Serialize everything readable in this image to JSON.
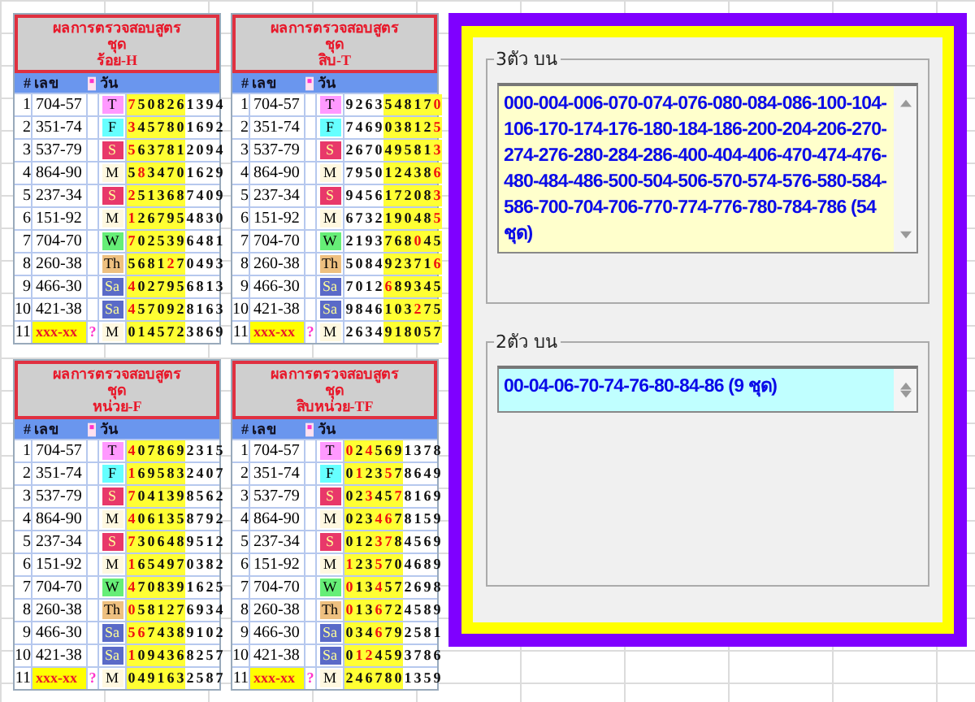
{
  "tables": [
    {
      "title": [
        "ผลการตรวจสอบสูตร",
        "ชุด",
        "ร้อย-H"
      ],
      "headers": [
        "#",
        "เลข",
        "วัน"
      ],
      "highlighted_columns": [
        true,
        true,
        true,
        true,
        true,
        true,
        false,
        false,
        false,
        false
      ],
      "rows": [
        {
          "index": "1",
          "number": "704-57",
          "kind": "entry",
          "day": {
            "label": "T",
            "color": "#ff99ff"
          },
          "digits": [
            "7",
            "5",
            "0",
            "8",
            "2",
            "6",
            "1",
            "3",
            "9",
            "4"
          ],
          "red": [
            true,
            false,
            false,
            false,
            false,
            false,
            false,
            false,
            false,
            false
          ]
        },
        {
          "index": "2",
          "number": "351-74",
          "kind": "entry",
          "day": {
            "label": "F",
            "color": "#66ffff"
          },
          "digits": [
            "3",
            "4",
            "5",
            "7",
            "8",
            "0",
            "1",
            "6",
            "9",
            "2"
          ],
          "red": [
            true,
            false,
            false,
            false,
            false,
            false,
            false,
            false,
            false,
            false
          ]
        },
        {
          "index": "3",
          "number": "537-79",
          "kind": "entry",
          "day": {
            "label": "S",
            "color": "#e8386a"
          },
          "digits": [
            "5",
            "6",
            "3",
            "7",
            "8",
            "1",
            "2",
            "0",
            "9",
            "4"
          ],
          "red": [
            true,
            false,
            false,
            false,
            false,
            false,
            false,
            false,
            false,
            false
          ]
        },
        {
          "index": "4",
          "number": "864-90",
          "kind": "entry",
          "day": {
            "label": "M",
            "color": "#fff8e0"
          },
          "digits": [
            "5",
            "8",
            "3",
            "4",
            "7",
            "0",
            "1",
            "6",
            "2",
            "9"
          ],
          "red": [
            false,
            true,
            false,
            false,
            false,
            false,
            false,
            false,
            false,
            false
          ]
        },
        {
          "index": "5",
          "number": "237-34",
          "kind": "entry",
          "day": {
            "label": "S",
            "color": "#e8386a"
          },
          "digits": [
            "2",
            "5",
            "1",
            "3",
            "6",
            "8",
            "7",
            "4",
            "0",
            "9"
          ],
          "red": [
            true,
            false,
            false,
            false,
            false,
            false,
            false,
            false,
            false,
            false
          ]
        },
        {
          "index": "6",
          "number": "151-92",
          "kind": "entry",
          "day": {
            "label": "M",
            "color": "#fff8e0"
          },
          "digits": [
            "1",
            "2",
            "6",
            "7",
            "9",
            "5",
            "4",
            "8",
            "3",
            "0"
          ],
          "red": [
            true,
            false,
            false,
            false,
            false,
            false,
            false,
            false,
            false,
            false
          ]
        },
        {
          "index": "7",
          "number": "704-70",
          "kind": "entry",
          "day": {
            "label": "W",
            "color": "#66ee77"
          },
          "digits": [
            "7",
            "0",
            "2",
            "5",
            "3",
            "9",
            "6",
            "4",
            "8",
            "1"
          ],
          "red": [
            true,
            false,
            false,
            false,
            false,
            false,
            false,
            false,
            false,
            false
          ]
        },
        {
          "index": "8",
          "number": "260-38",
          "kind": "entry",
          "day": {
            "label": "Th",
            "color": "#eec080"
          },
          "digits": [
            "5",
            "6",
            "8",
            "1",
            "2",
            "7",
            "0",
            "4",
            "9",
            "3"
          ],
          "red": [
            false,
            false,
            false,
            false,
            true,
            false,
            false,
            false,
            false,
            false
          ]
        },
        {
          "index": "9",
          "number": "466-30",
          "kind": "entry",
          "day": {
            "label": "Sa",
            "color": "#5a6ac8"
          },
          "digits": [
            "4",
            "0",
            "2",
            "7",
            "9",
            "5",
            "6",
            "8",
            "1",
            "3"
          ],
          "red": [
            true,
            false,
            false,
            false,
            false,
            false,
            false,
            false,
            false,
            false
          ]
        },
        {
          "index": "10",
          "number": "421-38",
          "kind": "entry",
          "day": {
            "label": "Sa",
            "color": "#5a6ac8"
          },
          "digits": [
            "4",
            "5",
            "7",
            "0",
            "9",
            "2",
            "8",
            "1",
            "6",
            "3"
          ],
          "red": [
            true,
            false,
            false,
            false,
            false,
            false,
            false,
            false,
            false,
            false
          ]
        },
        {
          "index": "11",
          "number": "xxx-xx",
          "kind": "pending",
          "mark": "?",
          "day": {
            "label": "M",
            "color": "#fff8e0"
          },
          "digits": [
            "0",
            "1",
            "4",
            "5",
            "7",
            "2",
            "3",
            "8",
            "6",
            "9"
          ],
          "red": [
            false,
            false,
            false,
            false,
            false,
            false,
            false,
            false,
            false,
            false
          ]
        }
      ]
    },
    {
      "title": [
        "ผลการตรวจสอบสูตร",
        "ชุด",
        "สิบ-T"
      ],
      "headers": [
        "#",
        "เลข",
        "วัน"
      ],
      "highlighted_columns": [
        false,
        false,
        false,
        false,
        true,
        true,
        true,
        true,
        true,
        true
      ],
      "rows": [
        {
          "index": "1",
          "number": "704-57",
          "kind": "entry",
          "day": {
            "label": "T",
            "color": "#ff99ff"
          },
          "digits": [
            "9",
            "2",
            "6",
            "3",
            "5",
            "4",
            "8",
            "1",
            "7",
            "0"
          ],
          "red": [
            false,
            false,
            false,
            false,
            false,
            false,
            false,
            false,
            false,
            true
          ]
        },
        {
          "index": "2",
          "number": "351-74",
          "kind": "entry",
          "day": {
            "label": "F",
            "color": "#66ffff"
          },
          "digits": [
            "7",
            "4",
            "6",
            "9",
            "0",
            "3",
            "8",
            "1",
            "2",
            "5"
          ],
          "red": [
            false,
            false,
            false,
            false,
            false,
            false,
            false,
            false,
            false,
            true
          ]
        },
        {
          "index": "3",
          "number": "537-79",
          "kind": "entry",
          "day": {
            "label": "S",
            "color": "#e8386a"
          },
          "digits": [
            "2",
            "6",
            "7",
            "0",
            "4",
            "9",
            "5",
            "8",
            "1",
            "3"
          ],
          "red": [
            false,
            false,
            false,
            false,
            false,
            false,
            false,
            false,
            false,
            true
          ]
        },
        {
          "index": "4",
          "number": "864-90",
          "kind": "entry",
          "day": {
            "label": "M",
            "color": "#fff8e0"
          },
          "digits": [
            "7",
            "9",
            "5",
            "0",
            "1",
            "2",
            "4",
            "3",
            "8",
            "6"
          ],
          "red": [
            false,
            false,
            false,
            false,
            false,
            false,
            false,
            false,
            false,
            true
          ]
        },
        {
          "index": "5",
          "number": "237-34",
          "kind": "entry",
          "day": {
            "label": "S",
            "color": "#e8386a"
          },
          "digits": [
            "9",
            "4",
            "5",
            "6",
            "1",
            "7",
            "2",
            "0",
            "8",
            "3"
          ],
          "red": [
            false,
            false,
            false,
            false,
            false,
            false,
            false,
            false,
            false,
            true
          ]
        },
        {
          "index": "6",
          "number": "151-92",
          "kind": "entry",
          "day": {
            "label": "M",
            "color": "#fff8e0"
          },
          "digits": [
            "6",
            "7",
            "3",
            "2",
            "1",
            "9",
            "0",
            "4",
            "8",
            "5"
          ],
          "red": [
            false,
            false,
            false,
            false,
            false,
            false,
            false,
            false,
            false,
            true
          ]
        },
        {
          "index": "7",
          "number": "704-70",
          "kind": "entry",
          "day": {
            "label": "W",
            "color": "#66ee77"
          },
          "digits": [
            "2",
            "1",
            "9",
            "3",
            "7",
            "6",
            "8",
            "0",
            "4",
            "5"
          ],
          "red": [
            false,
            false,
            false,
            false,
            false,
            false,
            false,
            true,
            false,
            false
          ]
        },
        {
          "index": "8",
          "number": "260-38",
          "kind": "entry",
          "day": {
            "label": "Th",
            "color": "#eec080"
          },
          "digits": [
            "5",
            "0",
            "8",
            "4",
            "9",
            "2",
            "3",
            "7",
            "1",
            "6"
          ],
          "red": [
            false,
            false,
            false,
            false,
            false,
            false,
            false,
            false,
            false,
            true
          ]
        },
        {
          "index": "9",
          "number": "466-30",
          "kind": "entry",
          "day": {
            "label": "Sa",
            "color": "#5a6ac8"
          },
          "digits": [
            "7",
            "0",
            "1",
            "2",
            "6",
            "8",
            "9",
            "3",
            "4",
            "5"
          ],
          "red": [
            false,
            false,
            false,
            false,
            true,
            false,
            false,
            false,
            false,
            false
          ]
        },
        {
          "index": "10",
          "number": "421-38",
          "kind": "entry",
          "day": {
            "label": "Sa",
            "color": "#5a6ac8"
          },
          "digits": [
            "9",
            "8",
            "4",
            "6",
            "1",
            "0",
            "3",
            "2",
            "7",
            "5"
          ],
          "red": [
            false,
            false,
            false,
            false,
            false,
            false,
            false,
            true,
            false,
            false
          ]
        },
        {
          "index": "11",
          "number": "xxx-xx",
          "kind": "pending",
          "mark": "?",
          "day": {
            "label": "M",
            "color": "#fff8e0"
          },
          "digits": [
            "2",
            "6",
            "3",
            "4",
            "9",
            "1",
            "8",
            "0",
            "5",
            "7"
          ],
          "red": [
            false,
            false,
            false,
            false,
            false,
            false,
            false,
            false,
            false,
            false
          ]
        }
      ]
    },
    {
      "title": [
        "ผลการตรวจสอบสูตร",
        "ชุด",
        "หน่วย-F"
      ],
      "headers": [
        "#",
        "เลข",
        "วัน"
      ],
      "highlighted_columns": [
        true,
        true,
        true,
        true,
        true,
        true,
        false,
        false,
        false,
        false
      ],
      "rows": [
        {
          "index": "1",
          "number": "704-57",
          "kind": "entry",
          "day": {
            "label": "T",
            "color": "#ff99ff"
          },
          "digits": [
            "4",
            "0",
            "7",
            "8",
            "6",
            "9",
            "2",
            "3",
            "1",
            "5"
          ],
          "red": [
            true,
            false,
            false,
            false,
            false,
            false,
            false,
            false,
            false,
            false
          ]
        },
        {
          "index": "2",
          "number": "351-74",
          "kind": "entry",
          "day": {
            "label": "F",
            "color": "#66ffff"
          },
          "digits": [
            "1",
            "6",
            "9",
            "5",
            "8",
            "3",
            "2",
            "4",
            "0",
            "7"
          ],
          "red": [
            true,
            false,
            false,
            false,
            false,
            false,
            false,
            false,
            false,
            false
          ]
        },
        {
          "index": "3",
          "number": "537-79",
          "kind": "entry",
          "day": {
            "label": "S",
            "color": "#e8386a"
          },
          "digits": [
            "7",
            "0",
            "4",
            "1",
            "3",
            "9",
            "8",
            "5",
            "6",
            "2"
          ],
          "red": [
            true,
            false,
            false,
            false,
            false,
            false,
            false,
            false,
            false,
            false
          ]
        },
        {
          "index": "4",
          "number": "864-90",
          "kind": "entry",
          "day": {
            "label": "M",
            "color": "#fff8e0"
          },
          "digits": [
            "4",
            "0",
            "6",
            "1",
            "3",
            "5",
            "8",
            "7",
            "9",
            "2"
          ],
          "red": [
            true,
            false,
            false,
            false,
            false,
            false,
            false,
            false,
            false,
            false
          ]
        },
        {
          "index": "5",
          "number": "237-34",
          "kind": "entry",
          "day": {
            "label": "S",
            "color": "#e8386a"
          },
          "digits": [
            "7",
            "3",
            "0",
            "6",
            "4",
            "8",
            "9",
            "5",
            "1",
            "2"
          ],
          "red": [
            true,
            false,
            false,
            false,
            false,
            false,
            false,
            false,
            false,
            false
          ]
        },
        {
          "index": "6",
          "number": "151-92",
          "kind": "entry",
          "day": {
            "label": "M",
            "color": "#fff8e0"
          },
          "digits": [
            "1",
            "6",
            "5",
            "4",
            "9",
            "7",
            "0",
            "3",
            "8",
            "2"
          ],
          "red": [
            true,
            false,
            false,
            false,
            false,
            false,
            false,
            false,
            false,
            false
          ]
        },
        {
          "index": "7",
          "number": "704-70",
          "kind": "entry",
          "day": {
            "label": "W",
            "color": "#66ee77"
          },
          "digits": [
            "4",
            "7",
            "0",
            "8",
            "3",
            "9",
            "1",
            "6",
            "2",
            "5"
          ],
          "red": [
            true,
            false,
            false,
            false,
            false,
            false,
            false,
            false,
            false,
            false
          ]
        },
        {
          "index": "8",
          "number": "260-38",
          "kind": "entry",
          "day": {
            "label": "Th",
            "color": "#eec080"
          },
          "digits": [
            "0",
            "5",
            "8",
            "1",
            "2",
            "7",
            "6",
            "9",
            "3",
            "4"
          ],
          "red": [
            true,
            false,
            false,
            false,
            false,
            false,
            false,
            false,
            false,
            false
          ]
        },
        {
          "index": "9",
          "number": "466-30",
          "kind": "entry",
          "day": {
            "label": "Sa",
            "color": "#5a6ac8"
          },
          "digits": [
            "5",
            "6",
            "7",
            "4",
            "3",
            "8",
            "9",
            "1",
            "0",
            "2"
          ],
          "red": [
            true,
            true,
            false,
            false,
            false,
            false,
            false,
            false,
            false,
            false
          ]
        },
        {
          "index": "10",
          "number": "421-38",
          "kind": "entry",
          "day": {
            "label": "Sa",
            "color": "#5a6ac8"
          },
          "digits": [
            "1",
            "0",
            "9",
            "4",
            "3",
            "6",
            "8",
            "2",
            "5",
            "7"
          ],
          "red": [
            true,
            false,
            false,
            false,
            false,
            false,
            false,
            false,
            false,
            false
          ]
        },
        {
          "index": "11",
          "number": "xxx-xx",
          "kind": "pending",
          "mark": "?",
          "day": {
            "label": "M",
            "color": "#fff8e0"
          },
          "digits": [
            "0",
            "4",
            "9",
            "1",
            "6",
            "3",
            "2",
            "5",
            "8",
            "7"
          ],
          "red": [
            false,
            false,
            false,
            false,
            false,
            false,
            false,
            false,
            false,
            false
          ]
        }
      ]
    },
    {
      "title": [
        "ผลการตรวจสอบสูตร",
        "ชุด",
        "สิบหน่วย-TF"
      ],
      "headers": [
        "#",
        "เลข",
        "วัน"
      ],
      "highlighted_columns": [
        true,
        true,
        true,
        true,
        true,
        true,
        false,
        false,
        false,
        false
      ],
      "rows": [
        {
          "index": "1",
          "number": "704-57",
          "kind": "entry",
          "day": {
            "label": "T",
            "color": "#ff99ff"
          },
          "digits": [
            "0",
            "2",
            "4",
            "5",
            "6",
            "9",
            "1",
            "3",
            "7",
            "8"
          ],
          "red": [
            true,
            false,
            true,
            false,
            false,
            false,
            false,
            false,
            false,
            false
          ]
        },
        {
          "index": "2",
          "number": "351-74",
          "kind": "entry",
          "day": {
            "label": "F",
            "color": "#66ffff"
          },
          "digits": [
            "0",
            "1",
            "2",
            "3",
            "5",
            "7",
            "8",
            "6",
            "4",
            "9"
          ],
          "red": [
            false,
            true,
            false,
            false,
            true,
            false,
            false,
            false,
            false,
            false
          ]
        },
        {
          "index": "3",
          "number": "537-79",
          "kind": "entry",
          "day": {
            "label": "S",
            "color": "#e8386a"
          },
          "digits": [
            "0",
            "2",
            "3",
            "4",
            "5",
            "7",
            "8",
            "1",
            "6",
            "9"
          ],
          "red": [
            false,
            false,
            true,
            false,
            false,
            true,
            false,
            false,
            false,
            false
          ]
        },
        {
          "index": "4",
          "number": "864-90",
          "kind": "entry",
          "day": {
            "label": "M",
            "color": "#fff8e0"
          },
          "digits": [
            "0",
            "2",
            "3",
            "4",
            "6",
            "7",
            "8",
            "1",
            "5",
            "9"
          ],
          "red": [
            false,
            false,
            false,
            true,
            true,
            false,
            false,
            false,
            false,
            false
          ]
        },
        {
          "index": "5",
          "number": "237-34",
          "kind": "entry",
          "day": {
            "label": "S",
            "color": "#e8386a"
          },
          "digits": [
            "0",
            "1",
            "2",
            "3",
            "7",
            "8",
            "4",
            "5",
            "6",
            "9"
          ],
          "red": [
            false,
            false,
            false,
            true,
            true,
            false,
            false,
            false,
            false,
            false
          ]
        },
        {
          "index": "6",
          "number": "151-92",
          "kind": "entry",
          "day": {
            "label": "M",
            "color": "#fff8e0"
          },
          "digits": [
            "1",
            "2",
            "3",
            "5",
            "7",
            "0",
            "4",
            "6",
            "8",
            "9"
          ],
          "red": [
            true,
            false,
            false,
            true,
            false,
            false,
            false,
            false,
            false,
            false
          ]
        },
        {
          "index": "7",
          "number": "704-70",
          "kind": "entry",
          "day": {
            "label": "W",
            "color": "#66ee77"
          },
          "digits": [
            "0",
            "1",
            "3",
            "4",
            "5",
            "7",
            "2",
            "6",
            "9",
            "8"
          ],
          "red": [
            true,
            false,
            false,
            true,
            false,
            false,
            false,
            false,
            false,
            false
          ]
        },
        {
          "index": "8",
          "number": "260-38",
          "kind": "entry",
          "day": {
            "label": "Th",
            "color": "#eec080"
          },
          "digits": [
            "0",
            "1",
            "3",
            "6",
            "7",
            "2",
            "4",
            "5",
            "8",
            "9"
          ],
          "red": [
            true,
            false,
            false,
            true,
            false,
            false,
            false,
            false,
            false,
            false
          ]
        },
        {
          "index": "9",
          "number": "466-30",
          "kind": "entry",
          "day": {
            "label": "Sa",
            "color": "#5a6ac8"
          },
          "digits": [
            "0",
            "3",
            "4",
            "6",
            "7",
            "9",
            "2",
            "5",
            "8",
            "1"
          ],
          "red": [
            false,
            false,
            false,
            true,
            false,
            false,
            false,
            false,
            false,
            false
          ]
        },
        {
          "index": "10",
          "number": "421-38",
          "kind": "entry",
          "day": {
            "label": "Sa",
            "color": "#5a6ac8"
          },
          "digits": [
            "0",
            "1",
            "2",
            "4",
            "5",
            "9",
            "3",
            "7",
            "8",
            "6"
          ],
          "red": [
            false,
            true,
            true,
            false,
            false,
            false,
            false,
            false,
            false,
            false
          ]
        },
        {
          "index": "11",
          "number": "xxx-xx",
          "kind": "pending",
          "mark": "?",
          "day": {
            "label": "M",
            "color": "#fff8e0"
          },
          "digits": [
            "2",
            "4",
            "6",
            "7",
            "8",
            "0",
            "1",
            "3",
            "5",
            "9"
          ],
          "red": [
            false,
            false,
            false,
            false,
            false,
            false,
            false,
            false,
            false,
            false
          ]
        }
      ]
    }
  ],
  "results": [
    {
      "label": "3ตัว บน",
      "text": "000-004-006-070-074-076-080-084-086-100-104-106-170-174-176-180-184-186-200-204-206-270-274-276-280-284-286-400-404-406-470-474-476-480-484-486-500-504-506-570-574-576-580-584-586-700-704-706-770-774-776-780-784-786  (54 ชุด)",
      "color": "#ffffcc"
    },
    {
      "label": "2ตัว บน",
      "text": "00-04-06-70-74-76-80-84-86 (9 ชุด)",
      "color": "#c0ffff"
    }
  ]
}
